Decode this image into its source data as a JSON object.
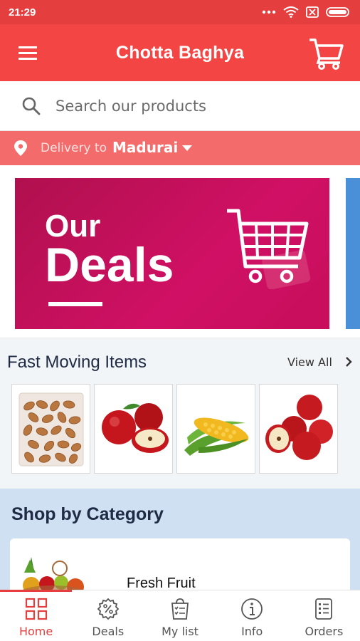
{
  "status_bar": {
    "time": "21:29"
  },
  "app_bar": {
    "title": "Chotta Baghya"
  },
  "search": {
    "placeholder": "Search our products"
  },
  "delivery": {
    "label": "Delivery to",
    "city": "Madurai"
  },
  "banner": {
    "line1": "Our",
    "line2": "Deals"
  },
  "fast_moving": {
    "title": "Fast Moving Items",
    "view_all": "View All",
    "items": [
      {
        "icon": "almonds-image"
      },
      {
        "icon": "apples-image"
      },
      {
        "icon": "corn-image"
      },
      {
        "icon": "red-apples-image"
      }
    ]
  },
  "category": {
    "title": "Shop by Category",
    "cards": [
      {
        "name": "Fresh Fruit",
        "icon": "fruit-basket-image"
      }
    ]
  },
  "bottom_nav": {
    "items": [
      {
        "label": "Home",
        "icon": "home-grid-icon",
        "active": true
      },
      {
        "label": "Deals",
        "icon": "deals-badge-icon"
      },
      {
        "label": "My list",
        "icon": "shopping-list-icon"
      },
      {
        "label": "Info",
        "icon": "info-icon"
      },
      {
        "label": "Orders",
        "icon": "orders-icon"
      }
    ]
  },
  "colors": {
    "primary": "#f44545",
    "delivery_bar": "#f36b6b",
    "banner": "#c80e5c",
    "category_bg": "#cfe0f2",
    "active": "#e53e3e"
  }
}
